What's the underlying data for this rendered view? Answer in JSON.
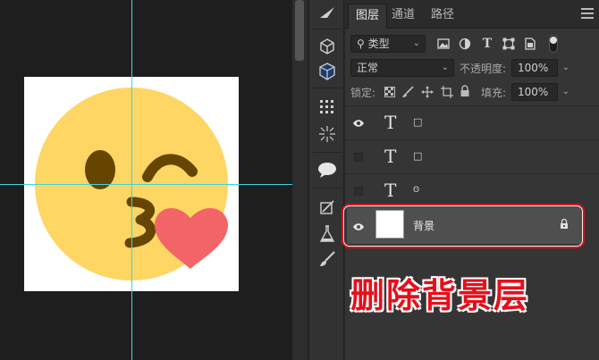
{
  "panel": {
    "tabs": [
      {
        "label": "图层",
        "active": true
      },
      {
        "label": "通道",
        "active": false
      },
      {
        "label": "路径",
        "active": false
      }
    ],
    "filter": {
      "label": "⚲ 类型"
    },
    "blend_mode": "正常",
    "opacity_label": "不透明度:",
    "opacity_value": "100%",
    "lock_label": "锁定:",
    "fill_label": "填充:",
    "fill_value": "100%"
  },
  "layers": [
    {
      "type": "text",
      "visible": true,
      "glyph": "T",
      "name": "□"
    },
    {
      "type": "text",
      "visible": false,
      "glyph": "T",
      "name": "□"
    },
    {
      "type": "text",
      "visible": false,
      "glyph": "T",
      "name": "ʘ"
    },
    {
      "type": "image",
      "visible": true,
      "name": "背景",
      "locked": true
    }
  ],
  "callout": "删除背景层",
  "colors": {
    "accent_red": "#e5101b",
    "guide": "#3ad6e0",
    "emoji_face": "#fdd663",
    "emoji_features": "#664500",
    "heart": "#f26467"
  }
}
